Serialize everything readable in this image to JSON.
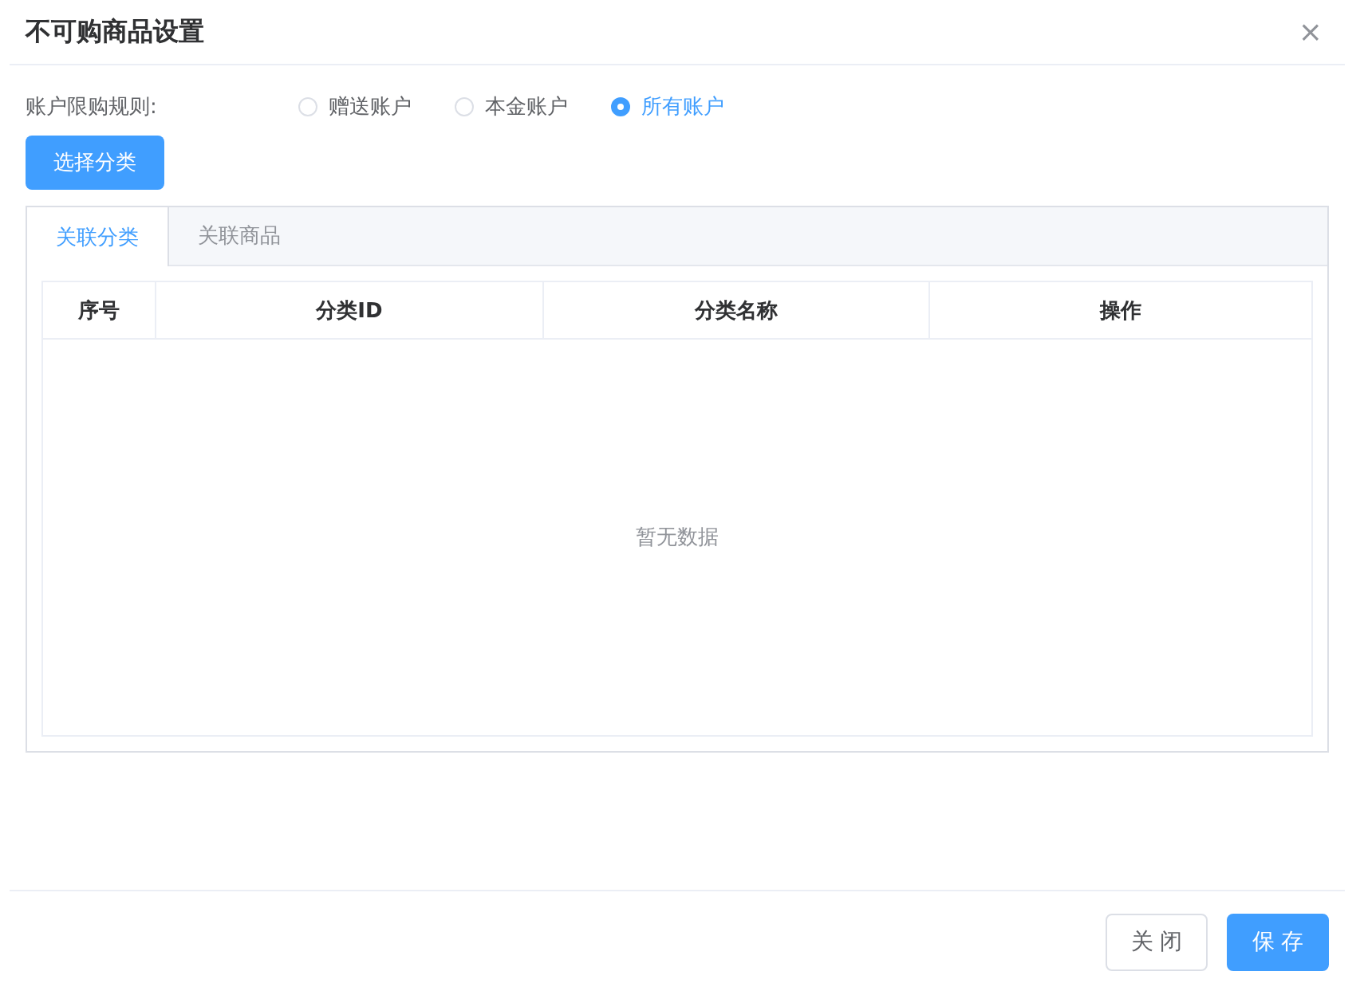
{
  "dialog": {
    "title": "不可购商品设置",
    "close": "×"
  },
  "rule": {
    "label": "账户限购规则:",
    "options": [
      {
        "label": "赠送账户",
        "selected": false
      },
      {
        "label": "本金账户",
        "selected": false
      },
      {
        "label": "所有账户",
        "selected": true
      }
    ]
  },
  "select_button": "选择分类",
  "tabs": [
    {
      "label": "关联分类",
      "selected": true
    },
    {
      "label": "关联商品",
      "selected": false
    }
  ],
  "table": {
    "columns": [
      "序号",
      "分类ID",
      "分类名称",
      "操作"
    ],
    "empty_text": "暂无数据"
  },
  "footer": {
    "buttons": [
      {
        "label": "关闭",
        "kind": "default"
      },
      {
        "label": "保存",
        "kind": "primary"
      }
    ]
  }
}
